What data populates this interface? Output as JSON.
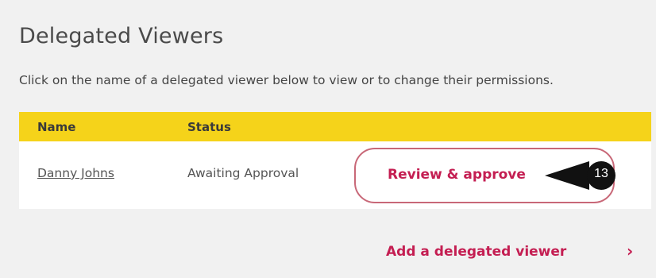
{
  "page": {
    "title": "Delegated Viewers",
    "intro": "Click on the name of a delegated viewer below to view or to change their permissions."
  },
  "table": {
    "headers": {
      "name": "Name",
      "status": "Status"
    },
    "rows": [
      {
        "name": "Danny Johns",
        "status": "Awaiting Approval",
        "action_label": "Review & approve"
      }
    ]
  },
  "callout": {
    "number": "13",
    "color": "#111111"
  },
  "add_viewer": {
    "label": "Add a delegated viewer",
    "icon": "chevron-right-icon",
    "glyph": "›"
  },
  "colors": {
    "header_bg": "#f5d31a",
    "accent": "#c41e52",
    "button_border": "#c86878",
    "page_bg": "#f1f1f1"
  }
}
